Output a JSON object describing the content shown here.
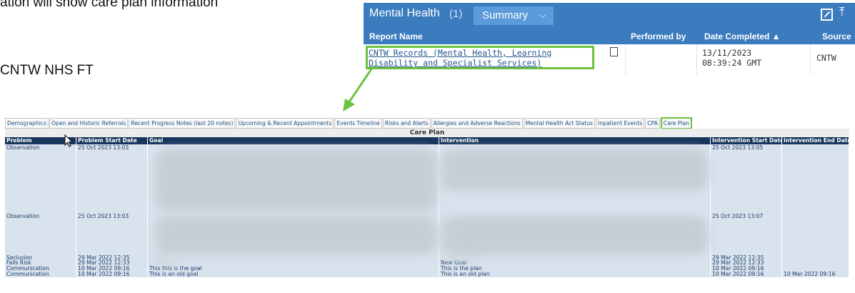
{
  "document": {
    "line1": "ation will show care plan information",
    "line2": "CNTW NHS FT"
  },
  "widget": {
    "title": "Mental Health",
    "count": "(1)",
    "view_select": "Summary",
    "columns": [
      "Report Name",
      "Performed by",
      "Date Completed ▲",
      "Source"
    ],
    "row": {
      "report_name": "CNTW Records (Mental Health, Learning Disability and Specialist Services)",
      "performed_by": "",
      "date_completed": "13/11/2023 08:39:24 GMT",
      "source": "CNTW"
    },
    "colors": {
      "header": "#3b7cbf",
      "highlight": "#6cc23f"
    }
  },
  "tabs": [
    "Demographics",
    "Open and Historic Referrals",
    "Recent Progress Notes (last 20 notes)",
    "Upcoming & Recent Appointments",
    "Events Timeline",
    "Risks and Alerts",
    "Allergies and Adverse Reactions",
    "Mental Health Act Status",
    "Inpatient Events",
    "CPA",
    "Care Plan"
  ],
  "active_tab": "Care Plan",
  "care_plan": {
    "title": "Care Plan",
    "columns": [
      "Problem",
      "Problem Start Date",
      "Goal",
      "Intervention",
      "Intervention Start Date",
      "Intervention End Date"
    ],
    "rows": [
      [
        "Observation",
        "25 Oct 2023 13:03",
        "",
        "",
        "25 Oct 2023 13:05",
        ""
      ],
      [
        "Observation",
        "25 Oct 2023 13:03",
        "",
        "",
        "25 Oct 2023 13:07",
        ""
      ],
      [
        "Seclusion",
        "29 Mar 2022 12:35",
        "",
        "",
        "29 Mar 2022 12:35",
        ""
      ],
      [
        "Falls Risk",
        "29 Mar 2022 12:33",
        "",
        "New Goal",
        "29 Mar 2022 12:33",
        ""
      ],
      [
        "Communication",
        "10 Mar 2022 09:16",
        "This this is the goal",
        "This is the plan",
        "10 Mar 2022 09:16",
        ""
      ],
      [
        "Communication",
        "10 Mar 2022 09:16",
        "This is an old goal",
        "This is an old plan",
        "10 Mar 2022 09:16",
        "10 Mar 2022 09:16"
      ]
    ]
  }
}
